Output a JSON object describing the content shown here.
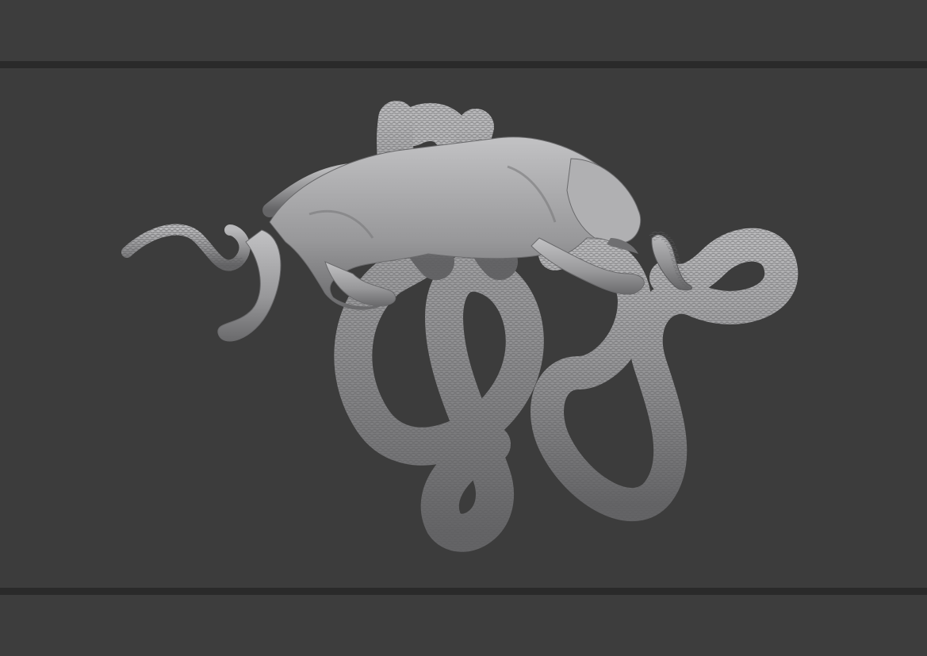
{
  "scene": {
    "subject": "sculpt-render",
    "colors": {
      "background": "#3c3c3c",
      "divider": "#2a2a2a",
      "clay": "#8d8d8f",
      "clay_highlight": "#b4b4b6",
      "clay_shadow": "#5a5a5c"
    }
  }
}
